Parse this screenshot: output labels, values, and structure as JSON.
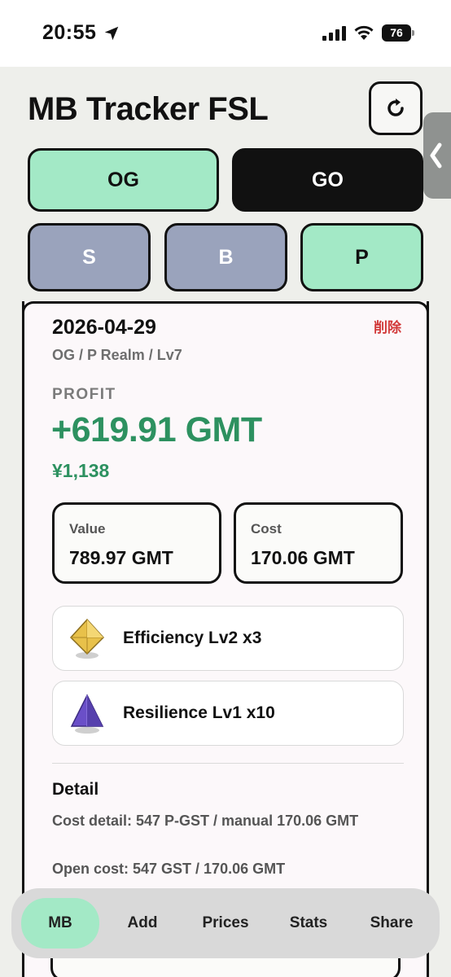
{
  "status_bar": {
    "time": "20:55",
    "battery": "76",
    "icons": [
      "location-arrow-icon",
      "signal-icon",
      "wifi-icon",
      "battery-icon"
    ]
  },
  "header": {
    "title": "MB Tracker FSL",
    "refresh_icon": "refresh-icon",
    "side_handle_icon": "chevron-left-icon"
  },
  "selector": {
    "row1": [
      {
        "label": "OG",
        "state": "selected"
      },
      {
        "label": "GO",
        "state": "dark"
      }
    ],
    "row2": [
      {
        "label": "S",
        "state": "unselected"
      },
      {
        "label": "B",
        "state": "unselected"
      },
      {
        "label": "P",
        "state": "selected"
      }
    ]
  },
  "entry": {
    "date": "2026-04-29",
    "delete_label": "削除",
    "meta": "OG / P Realm / Lv7",
    "profit_label": "PROFIT",
    "profit_value": "+619.91 GMT",
    "profit_yen": "¥1,138",
    "value": {
      "label": "Value",
      "amount": "789.97 GMT"
    },
    "cost": {
      "label": "Cost",
      "amount": "170.06 GMT"
    },
    "gems": [
      {
        "label": "Efficiency Lv2 x3",
        "icon": "yellow-gem-icon",
        "color": "#e8c14a"
      },
      {
        "label": "Resilience Lv1 x10",
        "icon": "purple-gem-icon",
        "color": "#6a4fc8"
      }
    ],
    "detail": {
      "title": "Detail",
      "cost_detail": "Cost detail: 547 P-GST / manual 170.06 GMT",
      "open_cost": "Open cost: 547 GST / 170.06 GMT"
    }
  },
  "nav": {
    "items": [
      {
        "label": "MB",
        "active": true
      },
      {
        "label": "Add",
        "active": false
      },
      {
        "label": "Prices",
        "active": false
      },
      {
        "label": "Stats",
        "active": false
      },
      {
        "label": "Share",
        "active": false
      }
    ]
  },
  "colors": {
    "mint": "#a3e9c6",
    "slate": "#9aa3bc",
    "profit_green": "#2d9160",
    "delete_red": "#d23a3a"
  }
}
